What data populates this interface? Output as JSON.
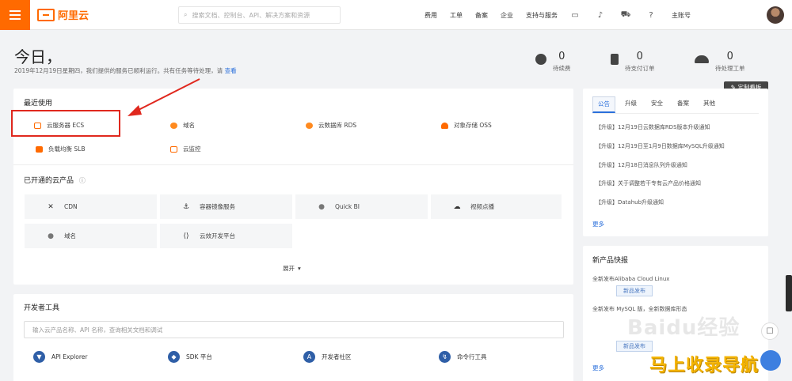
{
  "topbar": {
    "logo_text": "阿里云",
    "search_placeholder": "搜索文档、控制台、API、解决方案和资源",
    "nav": [
      "费用",
      "工单",
      "备案",
      "企业",
      "支持与服务"
    ],
    "user": "主账号"
  },
  "header": {
    "greeting": "今日，",
    "subtitle": "2019年12月19日星期四，我们提供的服务已顺利运行。共有任务等待处理，请",
    "subtitle_link": "查看",
    "stats": [
      {
        "value": "0",
        "label": "待续费"
      },
      {
        "value": "0",
        "label": "待支付订单"
      },
      {
        "value": "0",
        "label": "待处理工单"
      }
    ],
    "customize_label": "✎ 定制看板"
  },
  "recent": {
    "title": "最近使用",
    "items": [
      {
        "label": "云服务器 ECS",
        "color": "#ff6a00"
      },
      {
        "label": "域名",
        "color": "#ff8a1f"
      },
      {
        "label": "云数据库 RDS",
        "color": "#ff8a1f"
      },
      {
        "label": "对象存储 OSS",
        "color": "#ff6a00"
      },
      {
        "label": "负载均衡 SLB",
        "color": "#ff6a00"
      },
      {
        "label": "云监控",
        "color": "#ff6a00"
      }
    ]
  },
  "products": {
    "title": "已开通的云产品",
    "items": [
      {
        "icon": "✕",
        "label": "CDN"
      },
      {
        "icon": "⚓",
        "label": "容器镜像服务"
      },
      {
        "icon": "●",
        "label": "Quick BI"
      },
      {
        "icon": "☁",
        "label": "视频点播"
      },
      {
        "icon": "●",
        "label": "域名"
      },
      {
        "icon": "⟨⟩",
        "label": "云效开发平台"
      }
    ],
    "expand_label": "展开"
  },
  "devtools": {
    "title": "开发者工具",
    "input_placeholder": "输入云产品名称、API 名称，查询相关文档和调试",
    "tools": [
      {
        "label": "API Explorer"
      },
      {
        "label": "SDK 平台"
      },
      {
        "label": "开发者社区"
      },
      {
        "label": "命令行工具"
      }
    ]
  },
  "announcements": {
    "tabs": [
      "公告",
      "升级",
      "安全",
      "备案",
      "其他"
    ],
    "rows": [
      "【升级】12月19日云数据库RDS版本升级通知",
      "【升级】12月19日至1月9日数据库MySQL升级通知",
      "【升级】12月18日消息队列升级通知",
      "【升级】关于调整若干专有云产品价格通知",
      "【升级】Datahub升级通知"
    ],
    "more": "更多"
  },
  "news": {
    "title": "新产品快报",
    "rows": [
      {
        "text": "全新发布Alibaba Cloud Linux",
        "tag": "新品发布"
      },
      {
        "text": "全新发布 MySQL 版，全新数据库形态",
        "tag": ""
      },
      {
        "text": "",
        "tag": "新品发布"
      }
    ],
    "more": "更多"
  },
  "overlay": {
    "watermark": "Baidu经验",
    "brand": "马上收录导航"
  }
}
